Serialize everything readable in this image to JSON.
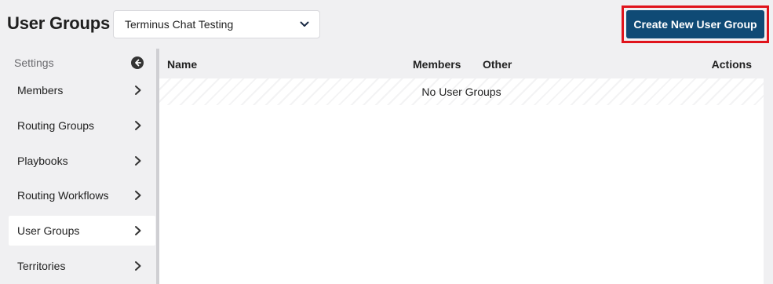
{
  "header": {
    "title": "User Groups",
    "org_select": {
      "value": "Terminus Chat Testing",
      "icon": "chevron-down-icon"
    },
    "create_button": "Create New User Group",
    "highlight_color": "#e0141c",
    "button_color": "#0f4a75"
  },
  "sidebar": {
    "section_label": "Settings",
    "back_icon": "circle-arrow-left-icon",
    "items": [
      {
        "label": "Members",
        "active": false
      },
      {
        "label": "Routing Groups",
        "active": false
      },
      {
        "label": "Playbooks",
        "active": false
      },
      {
        "label": "Routing Workflows",
        "active": false
      },
      {
        "label": "User Groups",
        "active": true
      },
      {
        "label": "Territories",
        "active": false
      }
    ]
  },
  "table": {
    "columns": [
      "Name",
      "Members",
      "Other",
      "Actions"
    ],
    "empty_message": "No User Groups"
  }
}
